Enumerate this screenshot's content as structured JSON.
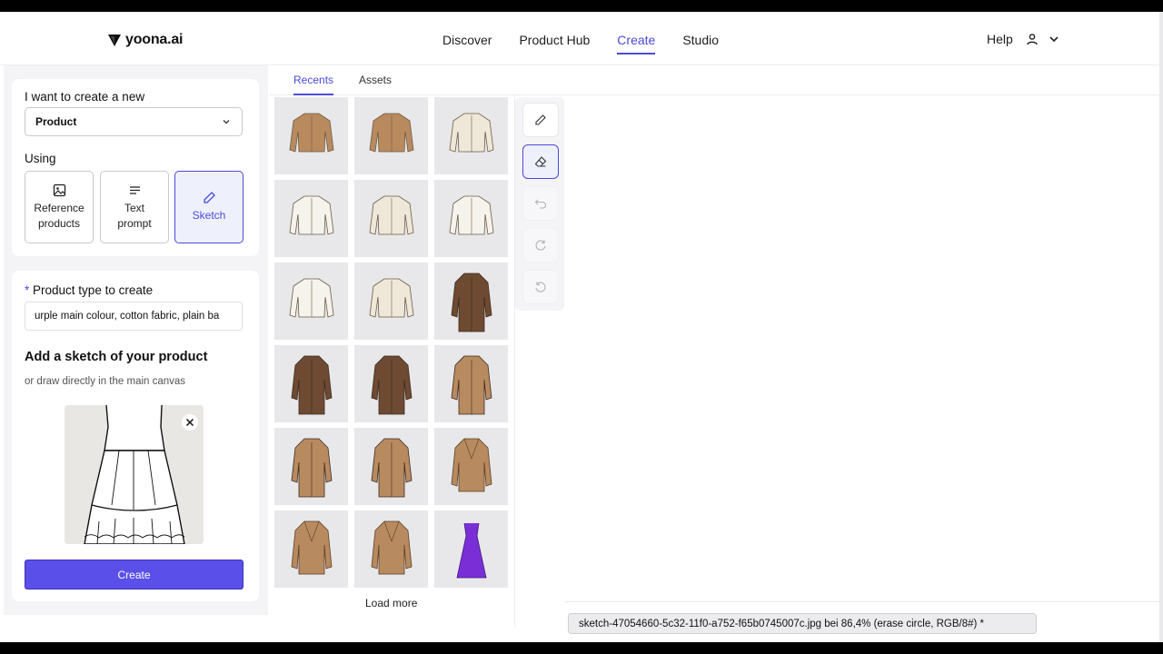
{
  "nav": {
    "logo_text": "yoona.ai",
    "links": [
      "Discover",
      "Product Hub",
      "Create",
      "Studio"
    ],
    "active": "Create",
    "help": "Help"
  },
  "sidebar": {
    "create_label": "I want to create a new",
    "create_value": "Product",
    "using_label": "Using",
    "options": [
      "Reference\nproducts",
      "Text\nprompt",
      "Sketch"
    ],
    "option_line1": [
      "Reference",
      "Text",
      "Sketch"
    ],
    "option_line2": [
      "products",
      "prompt",
      ""
    ],
    "selected_option": "Sketch",
    "type_label": "Product type to create",
    "required_mark": "*",
    "type_value": "urple main colour, cotton fabric, plain ba",
    "sketch_heading": "Add a sketch of your product",
    "sketch_sub": "or draw directly in the main canvas",
    "create_button": "Create"
  },
  "tabs": {
    "recents": "Recents",
    "assets": "Assets",
    "active": "Recents"
  },
  "gallery": {
    "items": [
      "cropped-jacket-tan",
      "cropped-jacket-tan",
      "cropped-jacket-cream",
      "cropped-jacket-white",
      "cropped-jacket-cream",
      "cropped-jacket-white",
      "cropped-jacket-white",
      "cropped-jacket-cream",
      "long-coat-brown-check",
      "long-coat-brown-check",
      "long-coat-brown",
      "long-coat-camel",
      "long-coat-camel",
      "long-coat-camel-scarf",
      "blazer-camel",
      "blazer-camel",
      "blazer-camel",
      "dress-purple"
    ],
    "load_more": "Load more"
  },
  "toolbar": [
    "pencil-icon",
    "eraser-icon",
    "undo-icon",
    "redo-icon",
    "reset-icon"
  ],
  "status": "sketch-47054660-5c32-11f0-a752-f65b0745007c.jpg bei 86,4% (erase circle, RGB/8#) *",
  "colors": {
    "accent": "#4b4ad8",
    "button": "#5b4fe9",
    "tan": "#b98a5e",
    "cream": "#efe8d8",
    "brown": "#6e4a32",
    "camel": "#b88a60",
    "purple": "#7a2fd6"
  }
}
